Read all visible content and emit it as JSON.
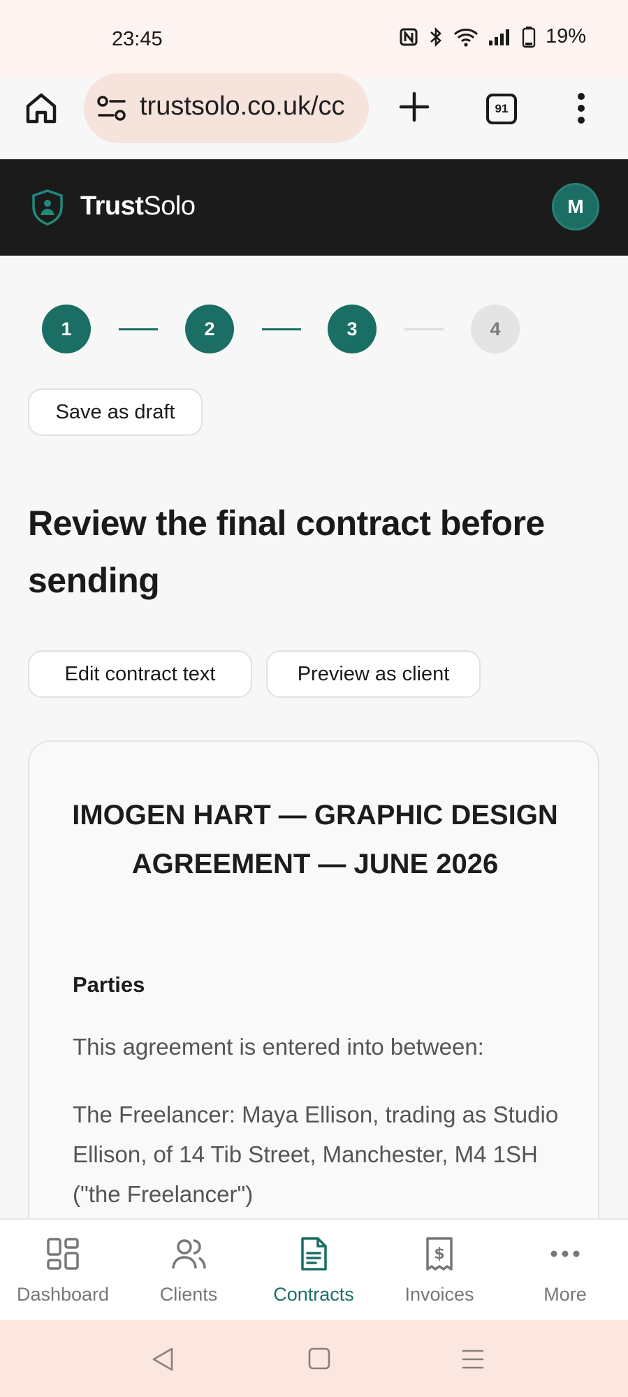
{
  "status_bar": {
    "time": "23:45",
    "battery": "19%"
  },
  "browser": {
    "url": "trustsolo.co.uk/cc",
    "tab_count": "91"
  },
  "app": {
    "brand_bold": "Trust",
    "brand_light": "Solo",
    "avatar_initial": "M"
  },
  "stepper": {
    "steps": [
      "1",
      "2",
      "3",
      "4"
    ],
    "current_step": 3
  },
  "actions": {
    "save_draft": "Save as draft",
    "edit_text": "Edit contract text",
    "preview_client": "Preview as client"
  },
  "page": {
    "title": "Review the final contract before sending"
  },
  "contract": {
    "title": "IMOGEN HART — GRAPHIC DESIGN AGREEMENT — JUNE 2026",
    "section_heading": "Parties",
    "intro": "This agreement is entered into between:",
    "freelancer": "The Freelancer: Maya Ellison, trading as Studio Ellison, of 14 Tib Street, Manchester, M4 1SH (\"the Freelancer\")"
  },
  "bottom_nav": {
    "dashboard": "Dashboard",
    "clients": "Clients",
    "contracts": "Contracts",
    "invoices": "Invoices",
    "more": "More",
    "active": "contracts"
  },
  "colors": {
    "accent": "#1a6e64",
    "header_bg": "#1b1b1b",
    "chrome_bg": "#fdf3f1"
  }
}
